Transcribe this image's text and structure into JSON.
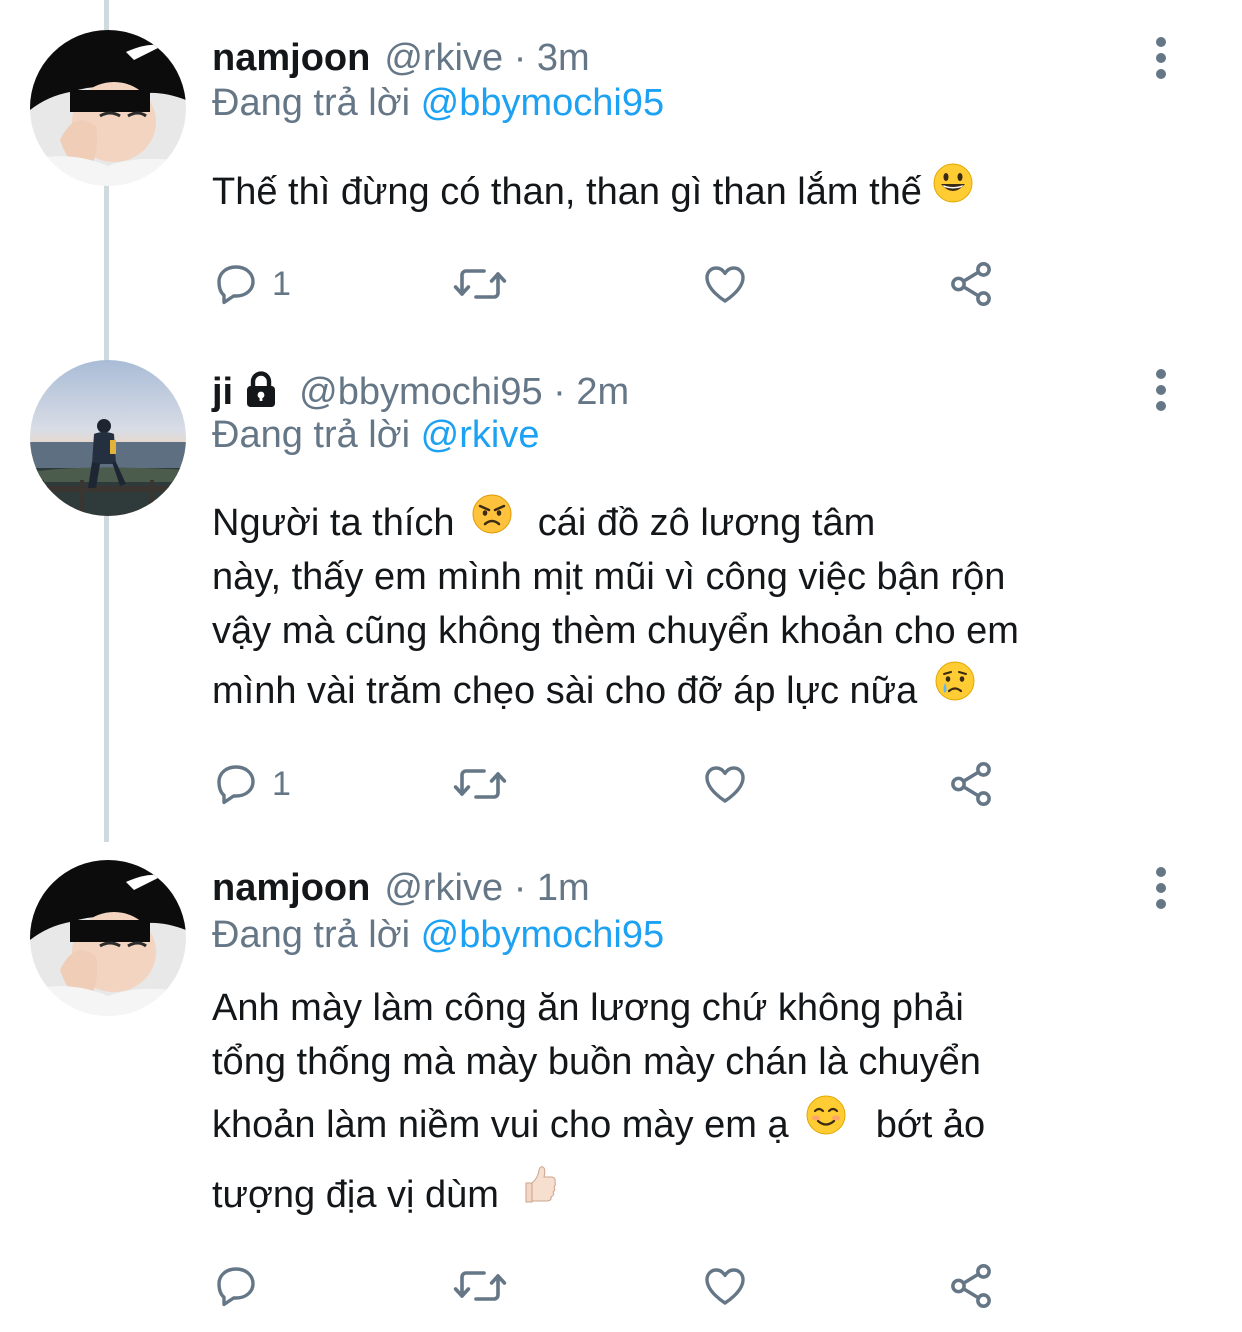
{
  "tweets": [
    {
      "display_name": "namjoon",
      "handle_time": "@rkive · 3m",
      "reply_prefix": "Đang trả lời",
      "reply_to": "@bbymochi95",
      "lines": [
        "Thế thì đừng có than, than gì than lắm thế"
      ],
      "emoji": [
        "grinning-face"
      ],
      "reply_count": "1"
    },
    {
      "display_name": "ji",
      "handle_time": "@bbymochi95 · 2m",
      "reply_prefix": "Đang trả lời",
      "reply_to": "@rkive",
      "lines": [
        "Người ta thích",
        "cái đồ zô lương tâm",
        "này, thấy em mình mịt mũi vì công việc bận rộn",
        "vậy mà cũng không thèm chuyển khoản cho em",
        "mình vài trăm chẹo sài cho đỡ áp lực nữa"
      ],
      "emoji": [
        "angry-face",
        "crying-face"
      ],
      "reply_count": "1",
      "locked": true
    },
    {
      "display_name": "namjoon",
      "handle_time": "@rkive · 1m",
      "reply_prefix": "Đang trả lời",
      "reply_to": "@bbymochi95",
      "lines": [
        "Anh mày làm công ăn lương chứ không phải",
        "tổng thống mà mày buồn mày chán là chuyển",
        "khoản làm niềm vui cho mày em ạ",
        "bớt ảo",
        "tượng địa vị dùm"
      ],
      "emoji": [
        "smiling-face",
        "thumbs-up"
      ],
      "reply_count": ""
    }
  ],
  "icons": {
    "reply": "reply-icon",
    "retweet": "retweet-icon",
    "like": "like-icon",
    "share": "share-icon",
    "more": "more-icon",
    "lock": "lock-icon"
  },
  "colors": {
    "text": "#14171a",
    "muted": "#657786",
    "mention": "#1da1f2",
    "thread_line": "#cfd9de"
  }
}
